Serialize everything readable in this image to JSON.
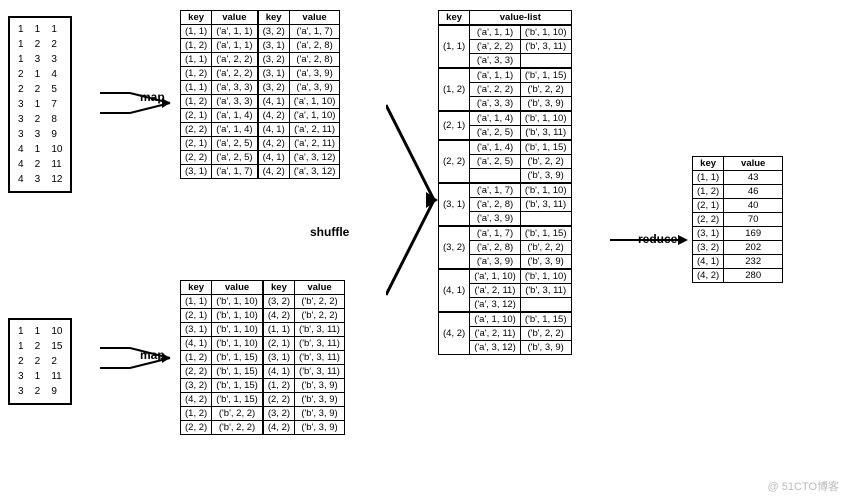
{
  "watermark": "@ 51CTO博客",
  "labels": {
    "map1": "map",
    "map2": "map",
    "shuffle": "shuffle",
    "reduce": "reduce"
  },
  "headers": {
    "key": "key",
    "value": "value",
    "valuelist": "value-list"
  },
  "input1": [
    "1  1  1",
    "1  2  2",
    "1  3  3",
    "2  1  4",
    "2  2  5",
    "3  1  7",
    "3  2  8",
    "3  3  9",
    "4  1  10",
    "4  2  11",
    "4  3  12"
  ],
  "input2": [
    "1  1  10",
    "1  2  15",
    "2  2  2",
    "3  1  11",
    "3  2  9"
  ],
  "map1a": [
    [
      "(1, 1)",
      "('a', 1, 1)"
    ],
    [
      "(1, 2)",
      "('a', 1, 1)"
    ],
    [
      "(1, 1)",
      "('a', 2, 2)"
    ],
    [
      "(1, 2)",
      "('a', 2, 2)"
    ],
    [
      "(1, 1)",
      "('a', 3, 3)"
    ],
    [
      "(1, 2)",
      "('a', 3, 3)"
    ],
    [
      "(2, 1)",
      "('a', 1, 4)"
    ],
    [
      "(2, 2)",
      "('a', 1, 4)"
    ],
    [
      "(2, 1)",
      "('a', 2, 5)"
    ],
    [
      "(2, 2)",
      "('a', 2, 5)"
    ],
    [
      "(3, 1)",
      "('a', 1, 7)"
    ]
  ],
  "map1b": [
    [
      "(3, 2)",
      "('a', 1, 7)"
    ],
    [
      "(3, 1)",
      "('a', 2, 8)"
    ],
    [
      "(3, 2)",
      "('a', 2, 8)"
    ],
    [
      "(3, 1)",
      "('a', 3, 9)"
    ],
    [
      "(3, 2)",
      "('a', 3, 9)"
    ],
    [
      "(4, 1)",
      "('a', 1, 10)"
    ],
    [
      "(4, 2)",
      "('a', 1, 10)"
    ],
    [
      "(4, 1)",
      "('a', 2, 11)"
    ],
    [
      "(4, 2)",
      "('a', 2, 11)"
    ],
    [
      "(4, 1)",
      "('a', 3, 12)"
    ],
    [
      "(4, 2)",
      "('a', 3, 12)"
    ]
  ],
  "map2a": [
    [
      "(1, 1)",
      "('b', 1, 10)"
    ],
    [
      "(2, 1)",
      "('b', 1, 10)"
    ],
    [
      "(3, 1)",
      "('b', 1, 10)"
    ],
    [
      "(4, 1)",
      "('b', 1, 10)"
    ],
    [
      "(1, 2)",
      "('b', 1, 15)"
    ],
    [
      "(2, 2)",
      "('b', 1, 15)"
    ],
    [
      "(3, 2)",
      "('b', 1, 15)"
    ],
    [
      "(4, 2)",
      "('b', 1, 15)"
    ],
    [
      "(1, 2)",
      "('b', 2, 2)"
    ],
    [
      "(2, 2)",
      "('b', 2, 2)"
    ]
  ],
  "map2b": [
    [
      "(3, 2)",
      "('b', 2, 2)"
    ],
    [
      "(4, 2)",
      "('b', 2, 2)"
    ],
    [
      "(1, 1)",
      "('b', 3, 11)"
    ],
    [
      "(2, 1)",
      "('b', 3, 11)"
    ],
    [
      "(3, 1)",
      "('b', 3, 11)"
    ],
    [
      "(4, 1)",
      "('b', 3, 11)"
    ],
    [
      "(1, 2)",
      "('b', 3, 9)"
    ],
    [
      "(2, 2)",
      "('b', 3, 9)"
    ],
    [
      "(3, 2)",
      "('b', 3, 9)"
    ],
    [
      "(4, 2)",
      "('b', 3, 9)"
    ]
  ],
  "shuffle_groups": [
    {
      "k": "(1, 1)",
      "v": [
        [
          "('a', 1, 1)",
          "('b', 1, 10)"
        ],
        [
          "('a', 2, 2)",
          "('b', 3, 11)"
        ],
        [
          "('a', 3, 3)",
          ""
        ]
      ]
    },
    {
      "k": "(1, 2)",
      "v": [
        [
          "('a', 1, 1)",
          "('b', 1, 15)"
        ],
        [
          "('a', 2, 2)",
          "('b', 2, 2)"
        ],
        [
          "('a', 3, 3)",
          "('b', 3, 9)"
        ]
      ]
    },
    {
      "k": "(2, 1)",
      "v": [
        [
          "('a', 1, 4)",
          "('b', 1, 10)"
        ],
        [
          "('a', 2, 5)",
          "('b', 3, 11)"
        ]
      ]
    },
    {
      "k": "(2, 2)",
      "v": [
        [
          "('a', 1, 4)",
          "('b', 1, 15)"
        ],
        [
          "('a', 2, 5)",
          "('b', 2, 2)"
        ],
        [
          "",
          "('b', 3, 9)"
        ]
      ]
    },
    {
      "k": "(3, 1)",
      "v": [
        [
          "('a', 1, 7)",
          "('b', 1, 10)"
        ],
        [
          "('a', 2, 8)",
          "('b', 3, 11)"
        ],
        [
          "('a', 3, 9)",
          ""
        ]
      ]
    },
    {
      "k": "(3, 2)",
      "v": [
        [
          "('a', 1, 7)",
          "('b', 1, 15)"
        ],
        [
          "('a', 2, 8)",
          "('b', 2, 2)"
        ],
        [
          "('a', 3, 9)",
          "('b', 3, 9)"
        ]
      ]
    },
    {
      "k": "(4, 1)",
      "v": [
        [
          "('a', 1, 10)",
          "('b', 1, 10)"
        ],
        [
          "('a', 2, 11)",
          "('b', 3, 11)"
        ],
        [
          "('a', 3, 12)",
          ""
        ]
      ]
    },
    {
      "k": "(4, 2)",
      "v": [
        [
          "('a', 1, 10)",
          "('b', 1, 15)"
        ],
        [
          "('a', 2, 11)",
          "('b', 2, 2)"
        ],
        [
          "('a', 3, 12)",
          "('b', 3, 9)"
        ]
      ]
    }
  ],
  "result": [
    [
      "(1, 1)",
      "43"
    ],
    [
      "(1, 2)",
      "46"
    ],
    [
      "(2, 1)",
      "40"
    ],
    [
      "(2, 2)",
      "70"
    ],
    [
      "(3, 1)",
      "169"
    ],
    [
      "(3, 2)",
      "202"
    ],
    [
      "(4, 1)",
      "232"
    ],
    [
      "(4, 2)",
      "280"
    ]
  ]
}
